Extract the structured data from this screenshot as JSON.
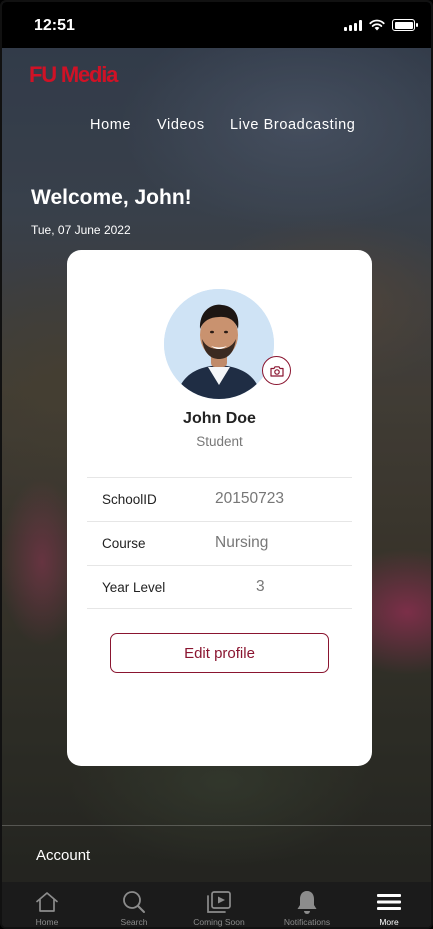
{
  "status_bar": {
    "time": "12:51"
  },
  "brand": {
    "logo_text": "FU Media",
    "accent_color": "#d01226",
    "button_color": "#8a1530"
  },
  "top_nav": [
    {
      "label": "Home"
    },
    {
      "label": "Videos"
    },
    {
      "label": "Live Broadcasting"
    }
  ],
  "greeting": {
    "title": "Welcome, John!",
    "date": "Tue, 07 June 2022"
  },
  "profile": {
    "name": "John Doe",
    "role": "Student",
    "change_photo_icon": "camera-icon",
    "details": [
      {
        "label": "SchoolID",
        "value": "20150723"
      },
      {
        "label": "Course",
        "value": "Nursing"
      },
      {
        "label": "Year Level",
        "value": "3"
      }
    ],
    "edit_label": "Edit profile"
  },
  "account": {
    "label": "Account"
  },
  "tab_bar": [
    {
      "label": "Home",
      "icon": "home-icon",
      "active": false
    },
    {
      "label": "Search",
      "icon": "search-icon",
      "active": false
    },
    {
      "label": "Coming Soon",
      "icon": "video-library-icon",
      "active": false
    },
    {
      "label": "Notifications",
      "icon": "bell-icon",
      "active": false
    },
    {
      "label": "More",
      "icon": "menu-icon",
      "active": true
    }
  ]
}
